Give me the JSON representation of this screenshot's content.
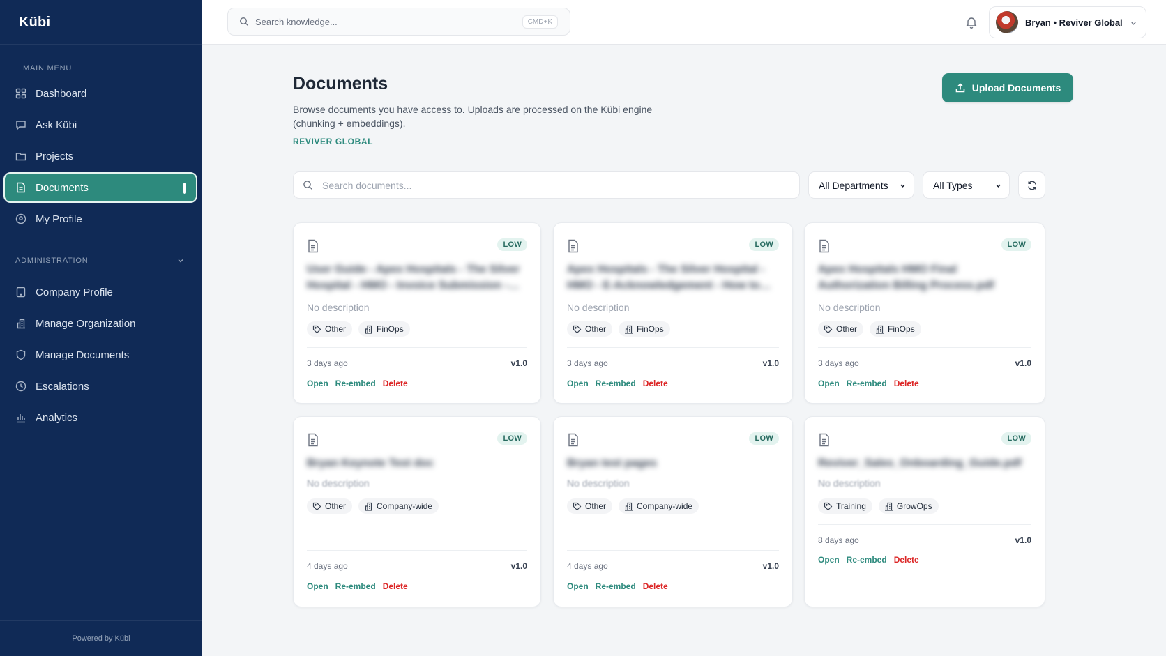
{
  "app": {
    "logo": "Kübi",
    "powered_by": "Powered by Kübi"
  },
  "sidebar": {
    "main_menu_label": "MAIN MENU",
    "main_items": [
      {
        "label": "Dashboard",
        "icon": "grid-icon"
      },
      {
        "label": "Ask Kübi",
        "icon": "chat-icon"
      },
      {
        "label": "Projects",
        "icon": "folder-icon"
      },
      {
        "label": "Documents",
        "icon": "document-icon",
        "active": true
      },
      {
        "label": "My Profile",
        "icon": "user-circle-icon"
      }
    ],
    "admin_label": "ADMINISTRATION",
    "admin_items": [
      {
        "label": "Company Profile",
        "icon": "building-icon"
      },
      {
        "label": "Manage Organization",
        "icon": "org-icon"
      },
      {
        "label": "Manage Documents",
        "icon": "shield-icon"
      },
      {
        "label": "Escalations",
        "icon": "clock-icon"
      },
      {
        "label": "Analytics",
        "icon": "bar-chart-icon"
      }
    ]
  },
  "header": {
    "search_placeholder": "Search knowledge...",
    "shortcut": "CMD+K",
    "user_label": "Bryan • Reviver Global"
  },
  "main": {
    "title": "Documents",
    "description": "Browse documents you have access to. Uploads are processed on the Kübi engine (chunking + embeddings).",
    "org": "REVIVER GLOBAL",
    "upload_label": "Upload Documents",
    "search_placeholder": "Search documents...",
    "department_filter": "All Departments",
    "type_filter": "All Types"
  },
  "colors": {
    "accent": "#2d8a7d",
    "sidebar": "#102a56",
    "danger": "#dc2626"
  },
  "documents": [
    {
      "title": "User Guide - Apex Hospitals - The Silver Hospital - HMO - Invoice Submission - Final.pdf",
      "risk": "LOW",
      "description": "No description",
      "tag": "Other",
      "department": "FinOps",
      "age": "3 days ago",
      "version": "v1.0",
      "open": "Open",
      "reembed": "Re-embed",
      "delete": "Delete"
    },
    {
      "title": "Apex Hospitals - The Silver Hospital - HMO - E-Acknowledgement - How to Submit.pdf",
      "risk": "LOW",
      "description": "No description",
      "tag": "Other",
      "department": "FinOps",
      "age": "3 days ago",
      "version": "v1.0",
      "open": "Open",
      "reembed": "Re-embed",
      "delete": "Delete"
    },
    {
      "title": "Apex Hospitals HMO Final Authorization Billing Process.pdf",
      "risk": "LOW",
      "description": "No description",
      "tag": "Other",
      "department": "FinOps",
      "age": "3 days ago",
      "version": "v1.0",
      "open": "Open",
      "reembed": "Re-embed",
      "delete": "Delete"
    },
    {
      "title": "Bryan Keynote Test doc",
      "risk": "LOW",
      "description": "No description",
      "tag": "Other",
      "department": "Company-wide",
      "age": "4 days ago",
      "version": "v1.0",
      "open": "Open",
      "reembed": "Re-embed",
      "delete": "Delete"
    },
    {
      "title": "Bryan test pages",
      "risk": "LOW",
      "description": "No description",
      "tag": "Other",
      "department": "Company-wide",
      "age": "4 days ago",
      "version": "v1.0",
      "open": "Open",
      "reembed": "Re-embed",
      "delete": "Delete"
    },
    {
      "title": "Reviver_Sales_Onboarding_Guide.pdf",
      "risk": "LOW",
      "description": "No description",
      "tag": "Training",
      "department": "GrowOps",
      "age": "8 days ago",
      "version": "v1.0",
      "open": "Open",
      "reembed": "Re-embed",
      "delete": "Delete"
    }
  ]
}
